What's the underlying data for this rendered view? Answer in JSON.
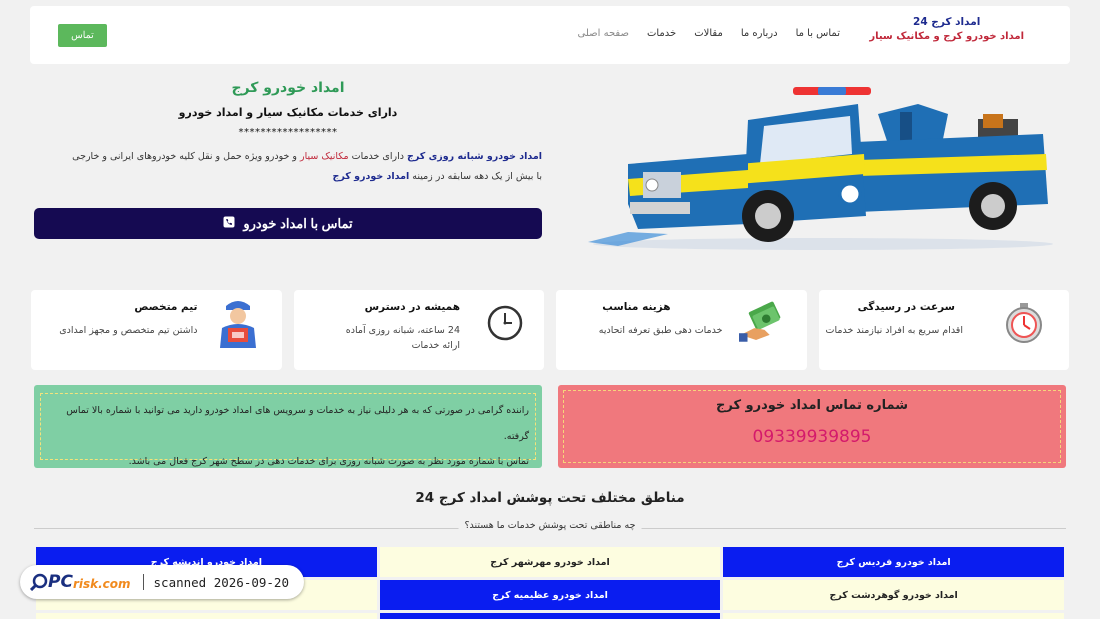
{
  "header": {
    "brand_title": "امداد کرج 24",
    "brand_sub": "امداد خودرو کرج و مکانیک سیار",
    "nav": [
      "صفحه اصلی",
      "خدمات",
      "مقالات",
      "درباره ما",
      "تماس با ما"
    ],
    "contact_button": "تماس"
  },
  "hero": {
    "title": "امداد خودرو کرج",
    "subtitle": "دارای خدمات مکانیک سیار و امداد خودرو",
    "stars": "******************",
    "p1_bold": "امداد خودرو شبانه روزی کرج",
    "p1_a": " دارای خدمات ",
    "p1_red": "مکانیک سیار",
    "p1_b": " و خودرو ویژه حمل و نقل کلیه خودروهای ایرانی و خارجی",
    "p2_a": "با بیش از یک دهه سابقه در زمینه ",
    "p2_bold": "امداد خودرو کرج",
    "cta": "تماس با امداد خودرو"
  },
  "features": [
    {
      "title": "سرعت در رسیدگی",
      "desc": "اقدام سریع به افراد نیازمند خدمات",
      "icon": "stopwatch-icon"
    },
    {
      "title": "هزینه مناسب",
      "desc": "خدمات دهی طبق تعرفه اتحادیه",
      "icon": "money-hand-icon"
    },
    {
      "title": "همیشه در دسترس",
      "desc": "24 ساعته، شبانه روزی آماده ارائه خدمات",
      "icon": "clock-icon"
    },
    {
      "title": "تیم متخصص",
      "desc": "داشتن تیم متخصص و مجهز امدادی",
      "icon": "mechanic-icon"
    }
  ],
  "phone_box": {
    "title": "شماره تماس امداد خودرو کرج",
    "number": "09339939895"
  },
  "note_box": {
    "line1": "راننده گرامی در صورتی که به هر دلیلی نیاز به خدمات و سرویس های امداد خودرو دارید می توانید با شماره بالا تماس گرفته.",
    "line2": "تماس با شماره مورد نظر به صورت شبانه روزی برای خدمات دهی در سطح شهر کرج فعال می باشد."
  },
  "areas": {
    "title": "مناطق مختلف تحت پوشش امداد کرج 24",
    "subtitle": "چه مناطقی تحت پوشش خدمات ما هستند؟",
    "cells": [
      {
        "label": "امداد خودرو فردیس کرج",
        "style": "blue"
      },
      {
        "label": "امداد خودرو مهرشهر کرج",
        "style": "cream"
      },
      {
        "label": "امداد خودرو اندیشه کرج",
        "style": "blue"
      },
      {
        "label": "امداد خودرو گوهردشت کرج",
        "style": "cream"
      },
      {
        "label": "امداد خودرو عظیمیه کرج",
        "style": "blue"
      },
      {
        "label": "",
        "style": "cream"
      },
      {
        "label": "",
        "style": "cream"
      },
      {
        "label": "",
        "style": "blue"
      },
      {
        "label": "",
        "style": "cream"
      }
    ]
  },
  "watermark": {
    "logo_pc": "PC",
    "logo_risk": "risk.com",
    "scan_text": "scanned 2026-09-20"
  }
}
